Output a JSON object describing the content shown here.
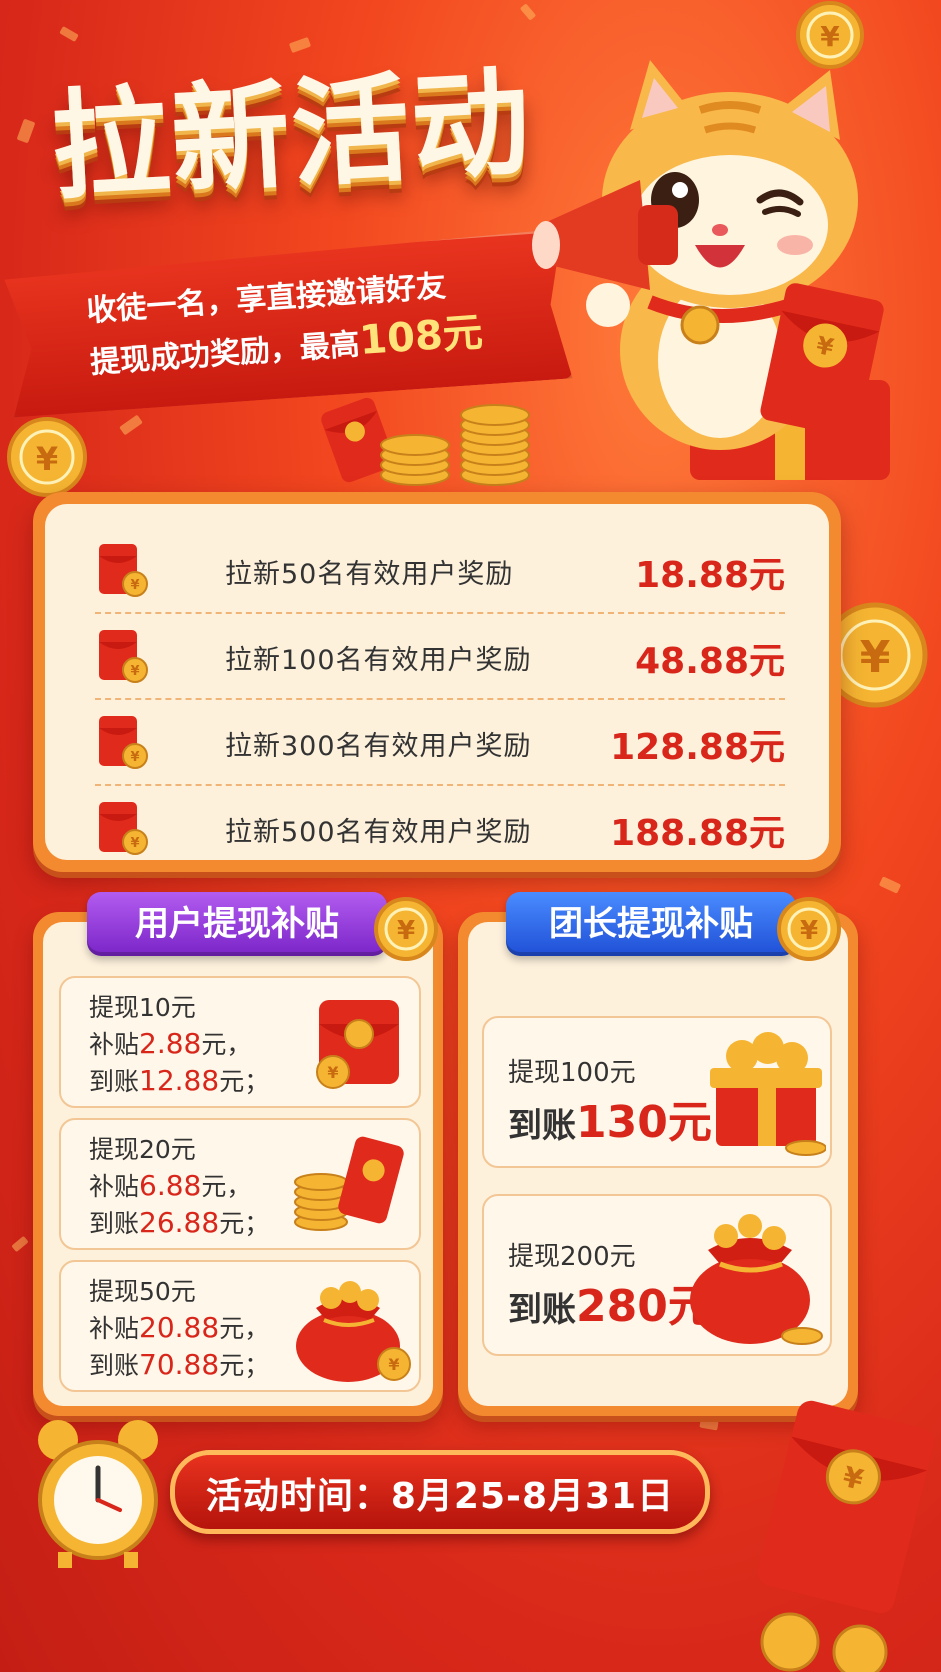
{
  "title": "拉新活动",
  "ribbon": {
    "line1": "收徒一名，享直接邀请好友",
    "line2_prefix": "提现成功奖励，最高",
    "line2_highlight": "108元"
  },
  "rewards": [
    {
      "label": "拉新50名有效用户奖励",
      "value": "18.88元"
    },
    {
      "label": "拉新100名有效用户奖励",
      "value": "48.88元"
    },
    {
      "label": "拉新300名有效用户奖励",
      "value": "128.88元"
    },
    {
      "label": "拉新500名有效用户奖励",
      "value": "188.88元"
    }
  ],
  "user_panel": {
    "tag": "用户提现补贴",
    "items": [
      {
        "l1": "提现10元",
        "l2_prefix": "补贴",
        "l2_value": "2.88",
        "l2_suffix": "元，",
        "l3_prefix": "到账",
        "l3_value": "12.88",
        "l3_suffix": "元；"
      },
      {
        "l1": "提现20元",
        "l2_prefix": "补贴",
        "l2_value": "6.88",
        "l2_suffix": "元，",
        "l3_prefix": "到账",
        "l3_value": "26.88",
        "l3_suffix": "元；"
      },
      {
        "l1": "提现50元",
        "l2_prefix": "补贴",
        "l2_value": "20.88",
        "l2_suffix": "元，",
        "l3_prefix": "到账",
        "l3_value": "70.88",
        "l3_suffix": "元；"
      }
    ]
  },
  "leader_panel": {
    "tag": "团长提现补贴",
    "items": [
      {
        "l1": "提现100元",
        "l2_prefix": "到账",
        "l2_value": "130元"
      },
      {
        "l1": "提现200元",
        "l2_prefix": "到账",
        "l2_value": "280元"
      }
    ]
  },
  "time": {
    "label": "活动时间：8月25-8月31日"
  },
  "colors": {
    "accent_red": "#d8261b",
    "gold": "#f5b532",
    "cream": "#fdf1dc",
    "purple": "#8a2fd6",
    "blue": "#2b5fe0"
  },
  "icons": [
    "megaphone-icon",
    "red-envelope-icon",
    "gold-coin-icon",
    "gift-box-icon",
    "money-bag-icon",
    "alarm-clock-icon",
    "cat-mascot"
  ]
}
